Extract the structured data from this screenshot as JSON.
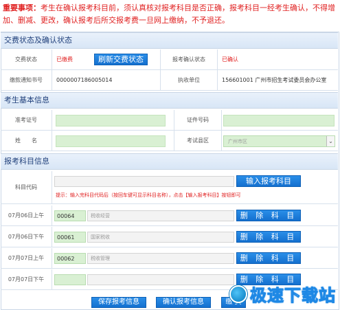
{
  "notice": {
    "label": "重要事项：",
    "text": "考生在确认报考科目前，须认真核对报考科目是否正确，报考科目一经考生确认，不得增加、删减、更改，确认报考后所交报考费一旦网上缴纳，不予退还。"
  },
  "fee_section": {
    "title": "交费状态及确认状态",
    "fee_status_label": "交费状态",
    "fee_status_value": "已缴费",
    "refresh_button": "刷新交费状态",
    "confirm_status_label": "报考确认状态",
    "confirm_status_value": "已确认",
    "notice_no_label": "缴款通知书号",
    "notice_no_value": "0000007186005014",
    "exec_unit_label": "执收单位",
    "exec_unit_value": "156601001 广州市招生考试委员会办公室"
  },
  "candidate_section": {
    "title": "考生基本信息",
    "ticket_label": "准考证号",
    "id_label": "证件号码",
    "name_label": "姓　　名",
    "district_label": "考试县区",
    "district_value": "广州市区"
  },
  "subject_section": {
    "title": "报考科目信息",
    "code_label": "科目代码",
    "input_button": "输入报考科目",
    "hint": "提示：输入完科目代码后（按回车键可显示科目名称），点击【输入报考科目】按钮即可",
    "delete_button": "删 除 科 目",
    "rows": [
      {
        "time": "07月06日上午",
        "code": "00064",
        "name": "税收经营"
      },
      {
        "time": "07月06日下午",
        "code": "00061",
        "name": "国家税收"
      },
      {
        "time": "07月07日上午",
        "code": "00062",
        "name": "税收管理"
      },
      {
        "time": "07月07日下午",
        "code": "",
        "name": ""
      }
    ]
  },
  "footer": {
    "save_button": "保存报考信息",
    "confirm_button": "确认报考信息",
    "pay_button": "缴 费"
  },
  "watermark": {
    "text": "极速下载站",
    "icon": "lightning-logo-icon"
  }
}
